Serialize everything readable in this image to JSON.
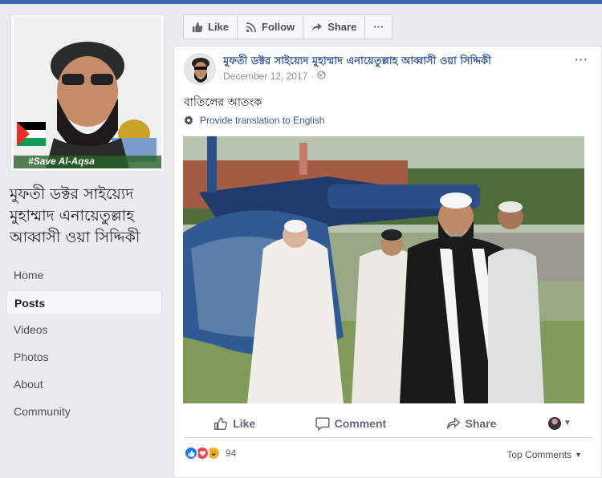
{
  "page": {
    "name": "মুফতী ডক্টর সাইয়্যেদ মুহাম্মাদ এনায়েতুল্লাহ আব্বাসী ওয়া সিদ্দিকী",
    "profile_badge": "#Save Al-Aqsa"
  },
  "nav": {
    "items": [
      {
        "label": "Home"
      },
      {
        "label": "Posts"
      },
      {
        "label": "Videos"
      },
      {
        "label": "Photos"
      },
      {
        "label": "About"
      },
      {
        "label": "Community"
      }
    ],
    "active": "Posts"
  },
  "toolbar": {
    "like_label": "Like",
    "follow_label": "Follow",
    "share_label": "Share",
    "more_label": "···"
  },
  "post": {
    "author": "মুফতী ডক্টর সাইয়্যেদ মুহাম্মাদ এনায়েতুল্লাহ আব্বাসী ওয়া সিদ্দিকী",
    "date": "December 12, 2017",
    "privacy_icon": "globe-icon",
    "text": "বাতিলের আতংক",
    "translate_label": "Provide translation to English",
    "actions": {
      "like": "Like",
      "comment": "Comment",
      "share": "Share"
    },
    "reaction_count": "94",
    "top_comments_label": "Top Comments"
  },
  "colors": {
    "brand": "#4267b2",
    "link": "#365899",
    "like": "#1877f2",
    "love": "#f33e58",
    "haha": "#f7b125"
  }
}
